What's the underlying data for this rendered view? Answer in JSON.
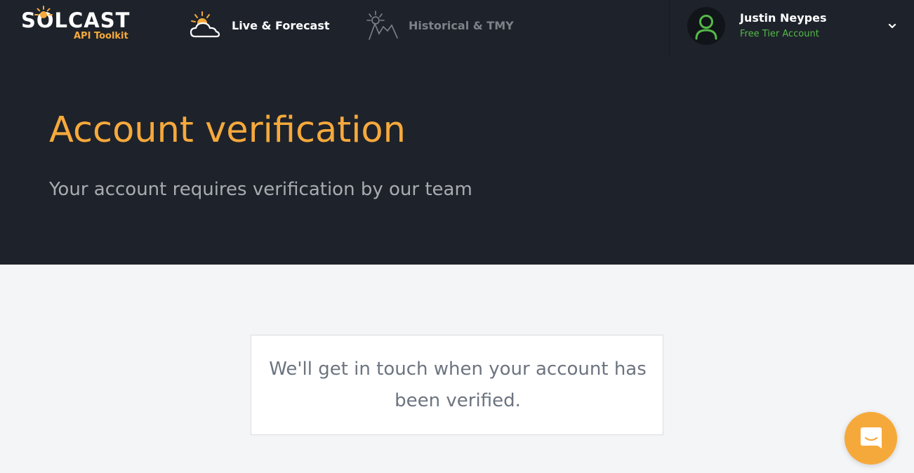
{
  "brand": {
    "name": "SOLCAST",
    "product": "API Toolkit",
    "accent_color": "#f6a93b"
  },
  "nav": {
    "items": [
      {
        "label": "Live & Forecast",
        "icon": "sun-cloud-icon",
        "active": true
      },
      {
        "label": "Historical & TMY",
        "icon": "historical-sun-chart-icon",
        "active": false
      }
    ]
  },
  "account": {
    "name": "Justin Neypes",
    "tier": "Free Tier Account",
    "tier_color": "#54b948",
    "avatar_icon": "user-icon",
    "menu_icon": "chevron-down-icon"
  },
  "hero": {
    "title": "Account verification",
    "subtitle": "Your account requires verification by our team"
  },
  "notice": {
    "message": "We'll get in touch when your account has been verified."
  },
  "chat": {
    "icon": "chat-bubble-icon",
    "color": "#f6a93b"
  }
}
